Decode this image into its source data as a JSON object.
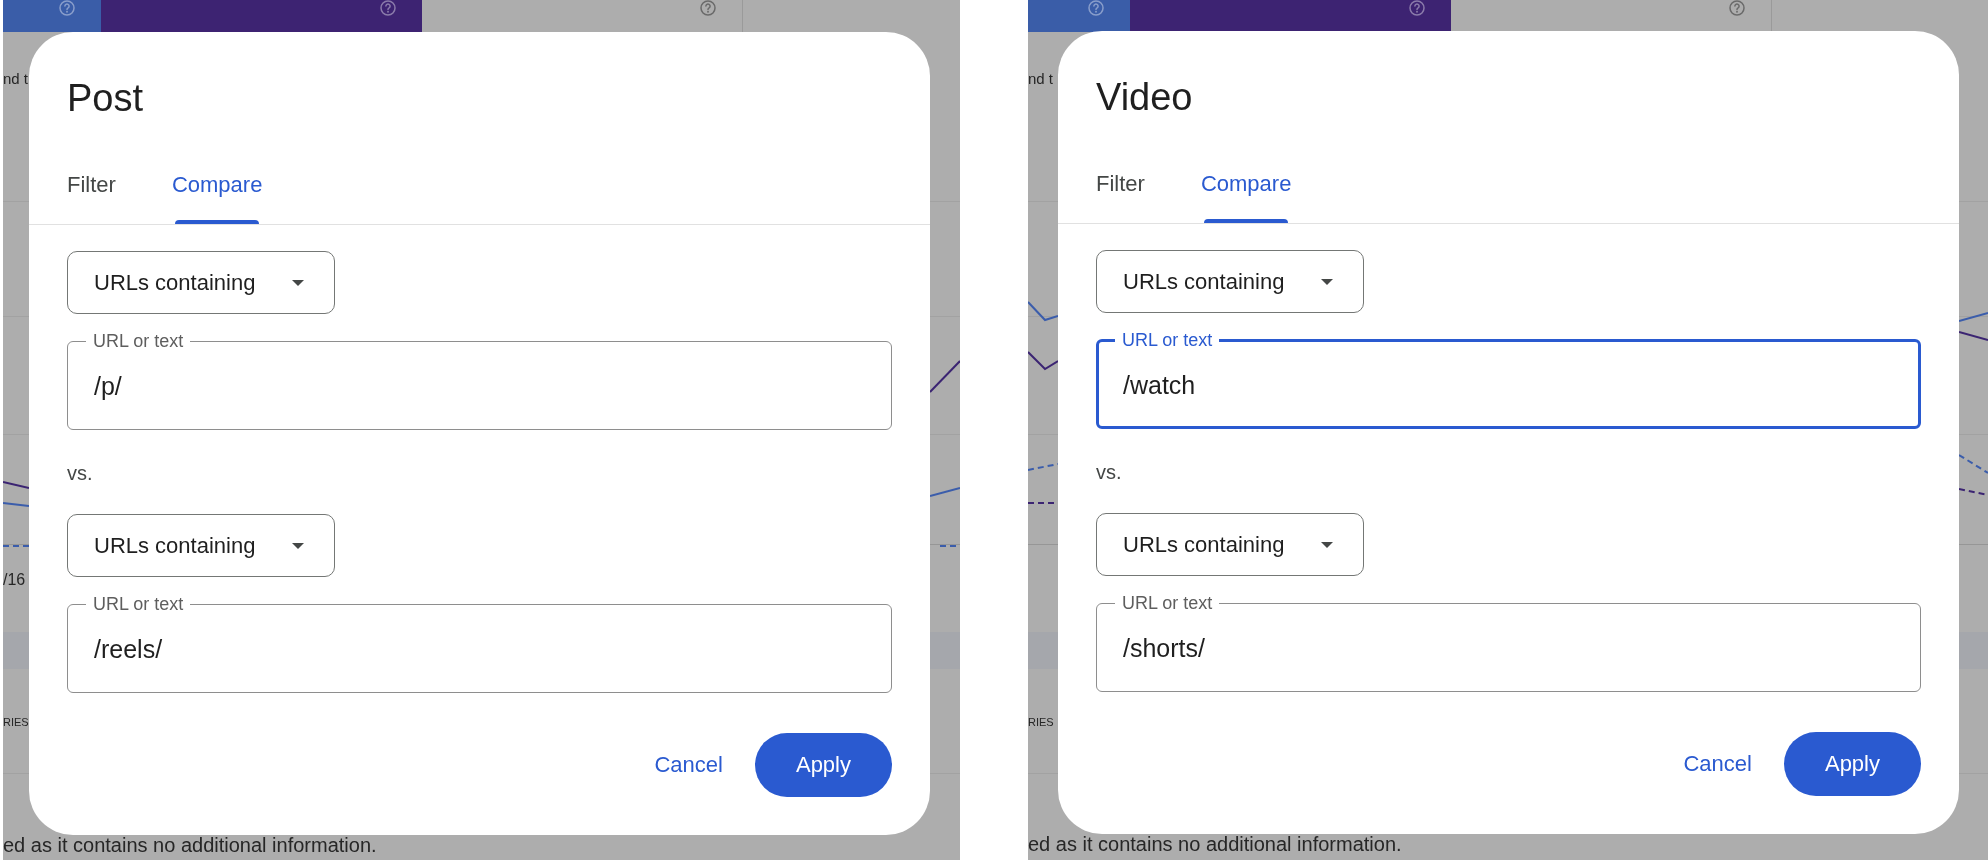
{
  "panels": [
    {
      "backdrop": {
        "metric_tiles": [
          {
            "selected": true,
            "color": "#3a5da8"
          },
          {
            "selected": true,
            "color": "#3d2372"
          },
          {
            "selected": false
          }
        ],
        "upper_text": "nd t",
        "axis_text": "/16",
        "tab_text": "RIES",
        "footer_text": "ed as it contains no additional information."
      },
      "dialog": {
        "title": "Post",
        "tabs": [
          {
            "label": "Filter",
            "selected": false
          },
          {
            "label": "Compare",
            "selected": true
          }
        ],
        "conditions": [
          {
            "match": "URLs containing",
            "label": "URL or text",
            "value": "/p/",
            "focused": false
          },
          {
            "match": "URLs containing",
            "label": "URL or text",
            "value": "/reels/",
            "focused": false
          }
        ],
        "separator": "vs.",
        "buttons": [
          {
            "label": "Cancel",
            "kind": "text"
          },
          {
            "label": "Apply",
            "kind": "filled"
          }
        ]
      }
    },
    {
      "backdrop": {
        "metric_tiles": [
          {
            "selected": true,
            "color": "#3a5da8"
          },
          {
            "selected": true,
            "color": "#3d2372"
          },
          {
            "selected": false
          }
        ],
        "upper_text": "nd t",
        "tab_text": "RIES",
        "footer_text": "ed as it contains no additional information."
      },
      "dialog": {
        "title": "Video",
        "tabs": [
          {
            "label": "Filter",
            "selected": false
          },
          {
            "label": "Compare",
            "selected": true
          }
        ],
        "conditions": [
          {
            "match": "URLs containing",
            "label": "URL or text",
            "value": "/watch",
            "focused": true
          },
          {
            "match": "URLs containing",
            "label": "URL or text",
            "value": "/shorts/",
            "focused": false
          }
        ],
        "separator": "vs.",
        "buttons": [
          {
            "label": "Cancel",
            "kind": "text"
          },
          {
            "label": "Apply",
            "kind": "filled"
          }
        ]
      }
    }
  ]
}
